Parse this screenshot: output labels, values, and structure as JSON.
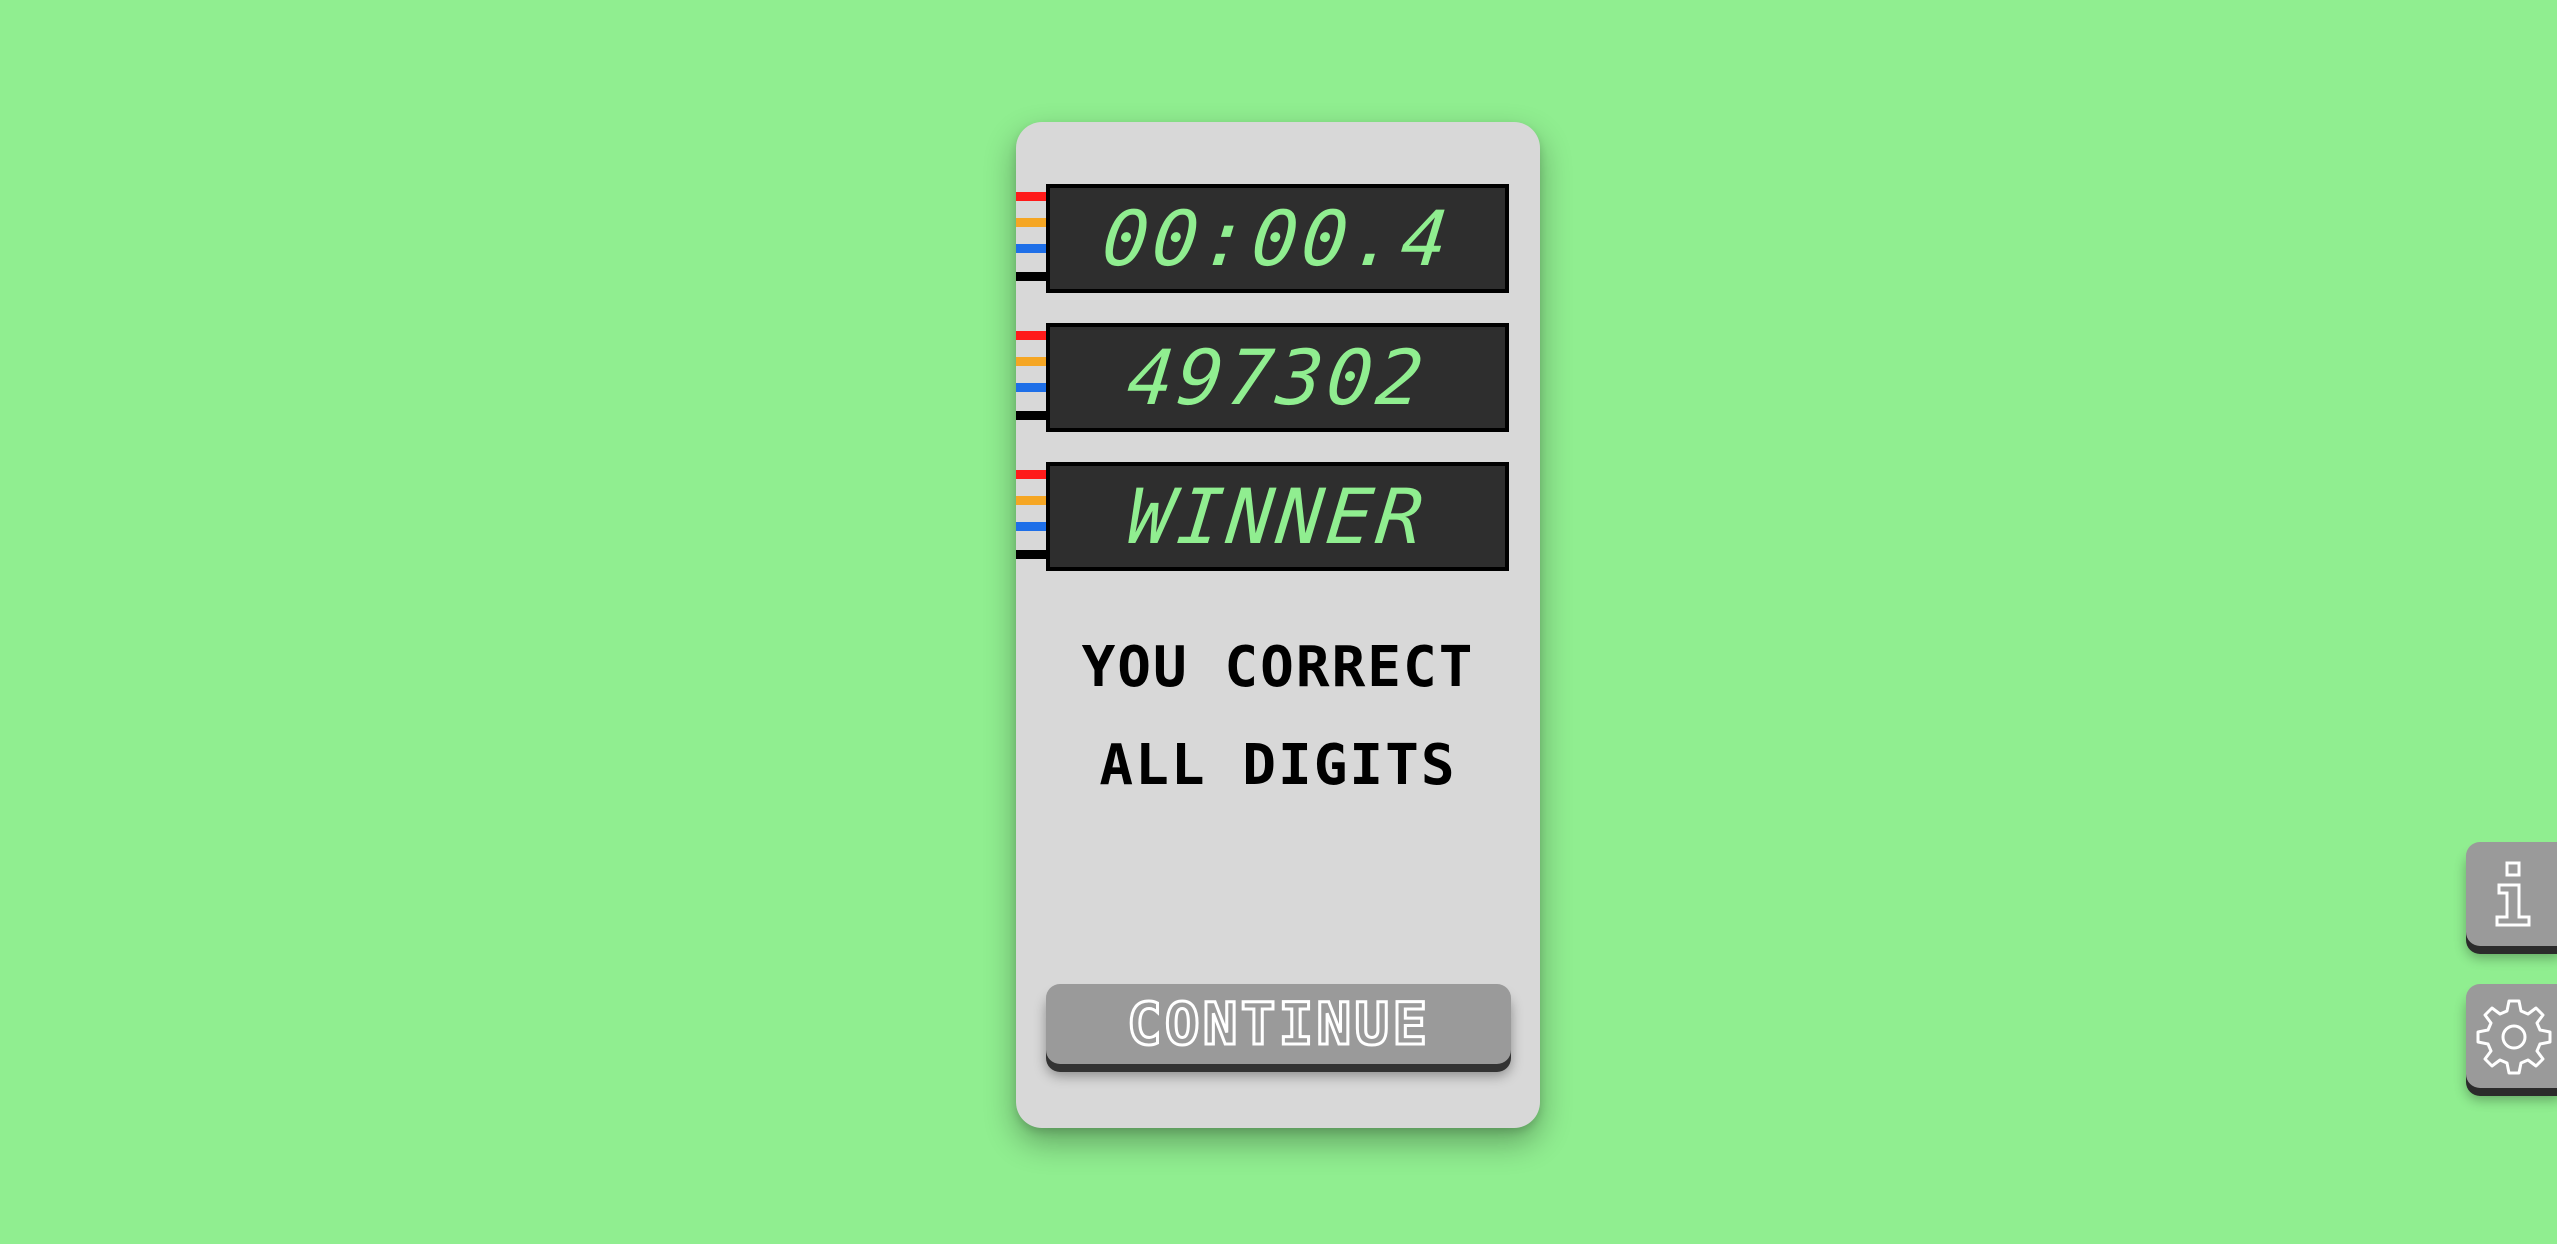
{
  "displays": {
    "timer": "00:00.4",
    "code": "497302",
    "status": "WINNER"
  },
  "message": {
    "line1": "YOU CORRECT",
    "line2": "ALL DIGITS"
  },
  "buttons": {
    "continue_label": "CONTINUE",
    "info_icon": "info-icon",
    "settings_icon": "gear-icon"
  },
  "colors": {
    "background": "#90ee90",
    "panel": "#d8d8d8",
    "lcd_background": "#2e2e2e",
    "lcd_text": "#90ee90",
    "wire_red": "#ff1a1a",
    "wire_orange": "#f5a623",
    "wire_blue": "#1e6fe8",
    "wire_black": "#000000",
    "button": "#9a9a9a"
  }
}
